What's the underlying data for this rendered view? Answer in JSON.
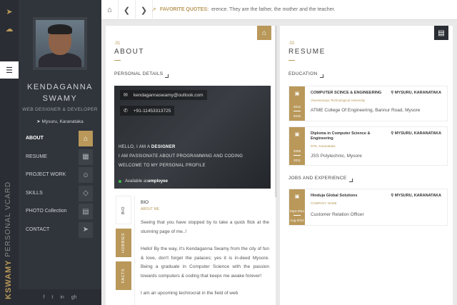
{
  "strip": {
    "vertical_name": "KSWAMY",
    "vertical_sub": "PERSONAL VCARD"
  },
  "profile": {
    "name_line1": "KENDAGANNA",
    "name_line2": "SWAMY",
    "role": "WEB DESIGNER & DEVELOPER",
    "location": "Mysuru, Karanataka"
  },
  "nav": [
    {
      "label": "ABOUT",
      "icon": "home-icon",
      "active": true
    },
    {
      "label": "RESUME",
      "icon": "id-card-icon",
      "active": false
    },
    {
      "label": "PROJECT WORK",
      "icon": "users-icon",
      "active": false
    },
    {
      "label": "SKILLS",
      "icon": "diamond-icon",
      "active": false
    },
    {
      "label": "PHOTO Collection",
      "icon": "archive-icon",
      "active": false
    },
    {
      "label": "CONTACT",
      "icon": "send-icon",
      "active": false
    }
  ],
  "social": [
    "f",
    "t",
    "in",
    "gh"
  ],
  "topbar": {
    "quote_label": "FAVORITE QUOTES:",
    "quote_text": "erence. They are the father, the mother and the teacher."
  },
  "about": {
    "number": ".01",
    "title": "ABOUT",
    "section": "PERSONAL DETAILS",
    "email": "kendagannaswamy@outlook.com",
    "phone": "+91-11453313725",
    "hello_prefix": "HELLO, I AM A ",
    "hello_bold": "DESIGNER",
    "line2": "I AM PASSIONATE ABOUT PROGRAMMING AND CODING",
    "line3": "WELCOME TO MY PERSONAL PROFILE",
    "avail_prefix": "Available as ",
    "avail_bold": "employee",
    "tabs": {
      "bio": "BIO",
      "hobbies": "HOBBIES",
      "facts": "FACTS"
    },
    "bio_title": "BIO",
    "bio_sub": "ABOUT ME",
    "bio_p1": "Seeing that you have stopped by to take a quick flick at the stunning page of me..!",
    "bio_p2": "Hello! By the way, it's Kendaganna Swamy from the city of fun & love, don't forget the palaces; yes it is in-deed Mysore. Being a graduate in Computer Science with the passion towards computers & coding that keeps me awake forever!",
    "bio_p3": "I am an upcoming technocrat in the field of web"
  },
  "resume": {
    "number": ".02",
    "title": "RESUME",
    "education_label": "EDUCATION",
    "jobs_label": "JOBS AND EXPERIENCE",
    "education": [
      {
        "title": "COMPUTER SCINCE & ENGINEERING",
        "location": "MYSURU, KARANATAKA",
        "institute": "Visvesvaraya Technological University",
        "detail": "ATME College Of Engineering, Bannur Road, Mysore",
        "from": "2012",
        "to": "2016"
      },
      {
        "title": "Diploma in Computer Science & Engineering",
        "location": "MYSURU, KARANATAKA",
        "institute": "DTE, Karanataka",
        "detail": "JSS Polytechnic, Mysore",
        "from": "2008",
        "to": "2011"
      }
    ],
    "jobs": [
      {
        "title": "Hinduja Global Solutions",
        "location": "MYSURU, KARANATAKA",
        "institute": "COMPANY NAME",
        "detail": "Customer Relation Officer",
        "from": "Sept-2011",
        "to": "Aug-2012"
      }
    ]
  },
  "colors": {
    "accent": "#b9985a",
    "sidebar": "#30343b",
    "strip": "#2a2d33"
  }
}
